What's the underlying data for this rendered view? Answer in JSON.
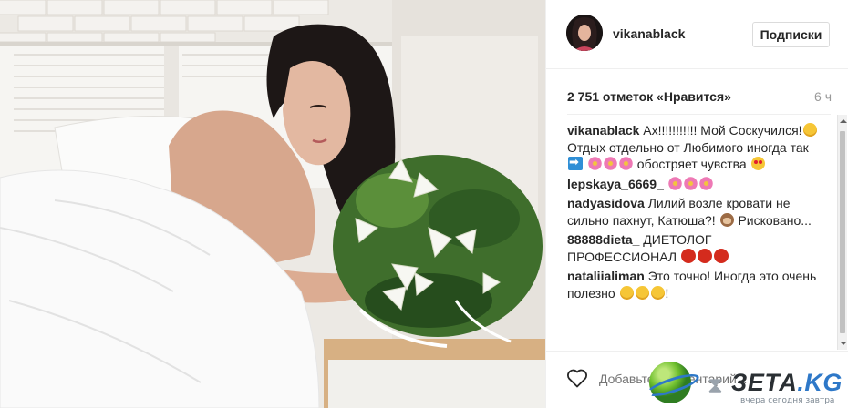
{
  "post": {
    "username": "vikanablack",
    "follow_label": "Подписки",
    "likes_text": "2 751 отметок «Нравится»",
    "time_ago": "6 ч",
    "comment_placeholder": "Добавьте комментарий...",
    "comments": [
      {
        "user": "vikanablack",
        "parts": [
          {
            "t": "text",
            "v": " Ах!!!!!!!!!!! Мой Соскучился!"
          },
          {
            "t": "emoji",
            "v": "smile"
          },
          {
            "t": "text",
            "v": "Отдых отдельно от Любимого иногда так "
          },
          {
            "t": "emoji",
            "v": "arrow"
          },
          {
            "t": "text",
            "v": " "
          },
          {
            "t": "emoji",
            "v": "flower"
          },
          {
            "t": "emoji",
            "v": "flower"
          },
          {
            "t": "emoji",
            "v": "flower"
          },
          {
            "t": "text",
            "v": " обостряет чувства "
          },
          {
            "t": "emoji",
            "v": "heart-eyes"
          }
        ]
      },
      {
        "user": "lepskaya_6669_",
        "parts": [
          {
            "t": "text",
            "v": " "
          },
          {
            "t": "emoji",
            "v": "flower"
          },
          {
            "t": "emoji",
            "v": "flower"
          },
          {
            "t": "emoji",
            "v": "flower"
          }
        ]
      },
      {
        "user": "nadyasidova",
        "parts": [
          {
            "t": "text",
            "v": " Лилий возле кровати не сильно пахнут, Катюша?! "
          },
          {
            "t": "emoji",
            "v": "monkey"
          },
          {
            "t": "text",
            "v": " Рисковано..."
          }
        ]
      },
      {
        "user": "88888dieta_",
        "parts": [
          {
            "t": "text",
            "v": " ДИЕТОЛОГ ПРОФЕССИОНАЛ "
          },
          {
            "t": "emoji",
            "v": "red"
          },
          {
            "t": "emoji",
            "v": "red"
          },
          {
            "t": "emoji",
            "v": "red"
          }
        ]
      },
      {
        "user": "nataliialiman",
        "parts": [
          {
            "t": "text",
            "v": " Это точно! Иногда это очень полезно "
          },
          {
            "t": "emoji",
            "v": "smile"
          },
          {
            "t": "emoji",
            "v": "smile"
          },
          {
            "t": "emoji",
            "v": "smile"
          },
          {
            "t": "text",
            "v": "!"
          }
        ]
      }
    ]
  },
  "watermark": {
    "brand": "ЗЕТА",
    "domain": ".KG",
    "tagline": "вчера сегодня завтра"
  },
  "icons": {
    "like": "heart-outline-icon",
    "scroll_up": "scroll-up-arrow",
    "scroll_down": "scroll-down-arrow"
  },
  "colors": {
    "text": "#262626",
    "muted": "#999999",
    "border": "#efefef"
  }
}
